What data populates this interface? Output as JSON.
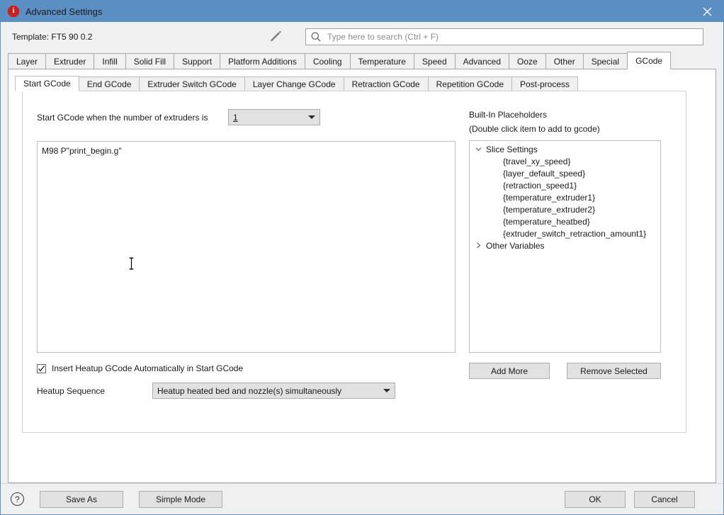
{
  "window": {
    "title": "Advanced Settings",
    "title_icon": "info-icon",
    "close_icon": "close-icon"
  },
  "template_bar": {
    "template_text": "Template: FT5 90 0.2",
    "edit_icon": "pencil-icon",
    "search": {
      "icon": "search-icon",
      "placeholder": "Type here to search (Ctrl + F)",
      "value": ""
    }
  },
  "main_tabs": {
    "active": "GCode",
    "items": [
      {
        "label": "Layer"
      },
      {
        "label": "Extruder"
      },
      {
        "label": "Infill"
      },
      {
        "label": "Solid Fill"
      },
      {
        "label": "Support"
      },
      {
        "label": "Platform Additions"
      },
      {
        "label": "Cooling"
      },
      {
        "label": "Temperature"
      },
      {
        "label": "Speed"
      },
      {
        "label": "Advanced"
      },
      {
        "label": "Ooze"
      },
      {
        "label": "Other"
      },
      {
        "label": "Special"
      },
      {
        "label": "GCode"
      }
    ]
  },
  "sub_tabs": {
    "active": "Start GCode",
    "items": [
      {
        "label": "Start GCode"
      },
      {
        "label": "End GCode"
      },
      {
        "label": "Extruder Switch GCode"
      },
      {
        "label": "Layer Change GCode"
      },
      {
        "label": "Retraction GCode"
      },
      {
        "label": "Repetition GCode"
      },
      {
        "label": "Post-process"
      }
    ]
  },
  "start_gcode": {
    "extruders_label": "Start GCode when the number of extruders is",
    "extruders_value": "1",
    "gcode_text": "M98 P\"print_begin.g\"",
    "insert_heatup_label": "Insert Heatup GCode Automatically in Start GCode",
    "insert_heatup_checked": true,
    "heatup_sequence_label": "Heatup Sequence",
    "heatup_sequence_value": "Heatup heated bed and nozzle(s) simultaneously"
  },
  "placeholders": {
    "title": "Built-In Placeholders",
    "subtitle": "(Double click item to add to gcode)",
    "tree": [
      {
        "label": "Slice Settings",
        "expanded": true,
        "chevron": "chevron-down-icon",
        "children": [
          "{travel_xy_speed}",
          "{layer_default_speed}",
          "{retraction_speed1}",
          "{temperature_extruder1}",
          "{temperature_extruder2}",
          "{temperature_heatbed}",
          "{extruder_switch_retraction_amount1}"
        ]
      },
      {
        "label": "Other Variables",
        "expanded": false,
        "chevron": "chevron-right-icon",
        "children": []
      }
    ],
    "add_more_label": "Add More",
    "remove_selected_label": "Remove Selected"
  },
  "footer": {
    "help_icon": "question-mark-icon",
    "help_glyph": "?",
    "save_as_label": "Save As",
    "simple_mode_label": "Simple Mode",
    "ok_label": "OK",
    "cancel_label": "Cancel"
  },
  "colors": {
    "titlebar": "#5b8fc4",
    "dialog_bg": "#f0f0f0",
    "panel_bg": "#ffffff",
    "button_face": "#e1e1e1",
    "icon_red": "#cc1f1f"
  }
}
